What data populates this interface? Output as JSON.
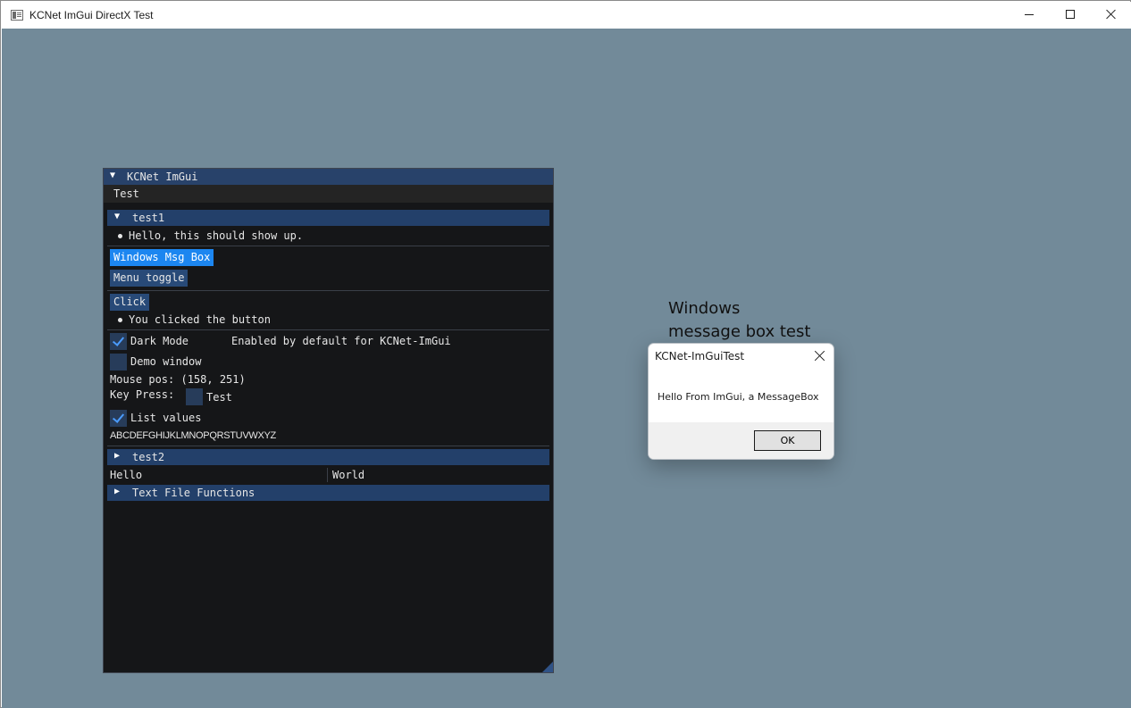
{
  "window": {
    "title": "KCNet ImGui DirectX Test",
    "client_background": "#728a99"
  },
  "imgui": {
    "title": "KCNet ImGui",
    "menu": "Test",
    "sections": {
      "test1": {
        "label": "test1",
        "expanded": true,
        "bullet_text": "Hello, this should show up.",
        "msgbox_button": "Windows Msg Box",
        "menu_toggle_button": "Menu toggle",
        "click_button": "Click",
        "clicked_text": "You clicked the button",
        "dark_mode": {
          "label": "Dark Mode",
          "checked": true,
          "note": "Enabled by default for KCNet-ImGui"
        },
        "demo_window": {
          "label": "Demo window",
          "checked": false
        },
        "mouse_pos": "Mouse pos: (158, 251)",
        "key_press": {
          "label": "Key Press:",
          "value": "Test"
        },
        "list_values": {
          "label": "List values",
          "checked": true
        },
        "alphabet": "ABCDEFGHIJKLMNOPQRSTUVWXYZ"
      },
      "test2": {
        "label": "test2",
        "expanded": false,
        "columns": [
          "Hello",
          "World"
        ]
      },
      "text_file_functions": {
        "label": "Text File Functions",
        "expanded": false
      }
    },
    "colors": {
      "window_bg": "#151618",
      "title_bg": "#28426a",
      "header_bg": "#23406a",
      "button_bg": "#284a78",
      "button_active": "#1c86f0",
      "check_mark": "#4a9bff"
    }
  },
  "annotation": {
    "line1": "Windows",
    "line2": "message box test"
  },
  "message_box": {
    "title": "KCNet-ImGuiTest",
    "message": "Hello From ImGui, a MessageBox",
    "ok_label": "OK"
  }
}
